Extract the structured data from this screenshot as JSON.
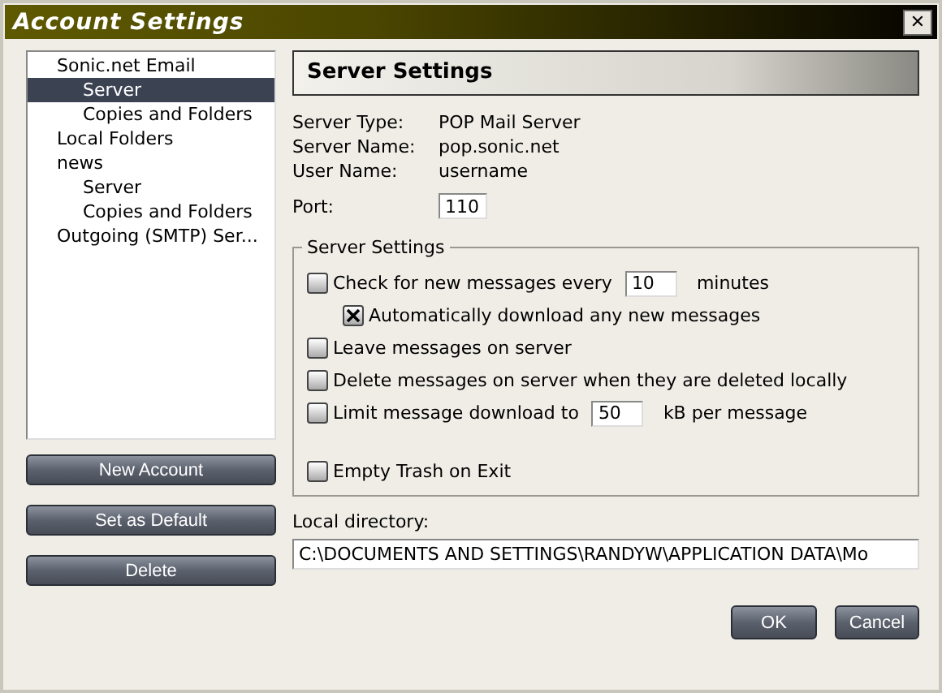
{
  "window": {
    "title": "Account Settings",
    "close": "✕"
  },
  "tree": [
    {
      "label": "Sonic.net Email",
      "selected": false,
      "children": [
        {
          "label": "Server",
          "selected": true
        },
        {
          "label": "Copies and Folders",
          "selected": false
        }
      ]
    },
    {
      "label": "Local Folders",
      "selected": false
    },
    {
      "label": "news",
      "selected": false,
      "children": [
        {
          "label": "Server",
          "selected": false
        },
        {
          "label": "Copies and Folders",
          "selected": false
        }
      ]
    },
    {
      "label": "Outgoing (SMTP) Ser...",
      "selected": false
    }
  ],
  "side_buttons": [
    "New Account",
    "Set as Default",
    "Delete"
  ],
  "header": "Server Settings",
  "info": [
    {
      "label": "Server Type:",
      "value": "POP Mail Server"
    },
    {
      "label": "Server Name:",
      "value": "pop.sonic.net"
    },
    {
      "label": "User Name:",
      "value": "username"
    }
  ],
  "port": {
    "label": "Port:",
    "value": "110"
  },
  "group": {
    "title": "Server Settings",
    "options": [
      {
        "kind": "field",
        "label": "Check for new messages every",
        "checked": false,
        "value": "10",
        "suffix": "minutes",
        "children": [
          {
            "label": "Automatically download any new messages",
            "checked": true
          }
        ]
      },
      {
        "kind": "plain",
        "label": "Leave messages on server",
        "checked": false
      },
      {
        "kind": "plain",
        "label": "Delete messages on server when they are deleted locally",
        "checked": false
      },
      {
        "kind": "field",
        "label": "Limit message download to",
        "checked": false,
        "value": "50",
        "suffix": "kB per message"
      },
      {
        "kind": "gap"
      },
      {
        "kind": "plain",
        "label": "Empty Trash on Exit",
        "checked": false
      }
    ]
  },
  "local_directory": {
    "label": "Local directory:",
    "value": "C:\\DOCUMENTS AND SETTINGS\\RANDYW\\APPLICATION DATA\\Mo"
  },
  "buttons": [
    "OK",
    "Cancel"
  ]
}
